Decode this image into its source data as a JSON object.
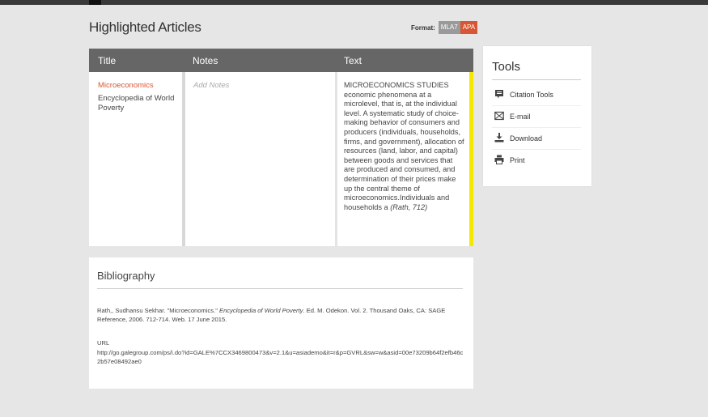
{
  "header": {
    "title": "Highlighted Articles"
  },
  "format": {
    "label": "Format:",
    "options": [
      "MLA7",
      "APA"
    ],
    "selected": "APA"
  },
  "table": {
    "columns": [
      "Title",
      "Notes",
      "Text"
    ],
    "row": {
      "title": "Microeconomics",
      "source": "Encyclopedia of World Poverty",
      "notes_placeholder": "Add Notes",
      "text": "MICROECONOMICS STUDIES economic phenomena at a microlevel, that is, at the individual level. A systematic study of choice-making behavior of consumers and producers (individuals, households, firms, and government), allocation of resources (land, labor, and capital) between goods and services that are produced and consumed, and determination of their prices make up the central theme of microeconomics.Individuals and households a",
      "cite": "(Rath, 712)",
      "highlight_color": "#f5e700"
    }
  },
  "tools": {
    "title": "Tools",
    "items": [
      {
        "label": "Citation Tools",
        "icon": "citation-icon"
      },
      {
        "label": "E-mail",
        "icon": "email-icon"
      },
      {
        "label": "Download",
        "icon": "download-icon"
      },
      {
        "label": "Print",
        "icon": "print-icon"
      }
    ]
  },
  "bibliography": {
    "title": "Bibliography",
    "citation_pre": "Rath,, Sudhansu Sekhar. \"Microeconomics.\" ",
    "citation_title": "Encyclopedia of World Poverty",
    "citation_post": ". Ed. M. Odekon. Vol. 2. Thousand Oaks, CA: SAGE Reference, 2006. 712-714. Web. 17 June 2015.",
    "url_label": "URL",
    "url": "http://go.galegroup.com/ps/i.do?id=GALE%7CCX3469800473&v=2.1&u=asiademo&it=r&p=GVRL&sw=w&asid=00e73209b64f2efb46c2b57e08492ae0"
  },
  "colors": {
    "accent": "#d85633",
    "header_bg": "#666666",
    "page_bg": "#e6e6e6"
  }
}
